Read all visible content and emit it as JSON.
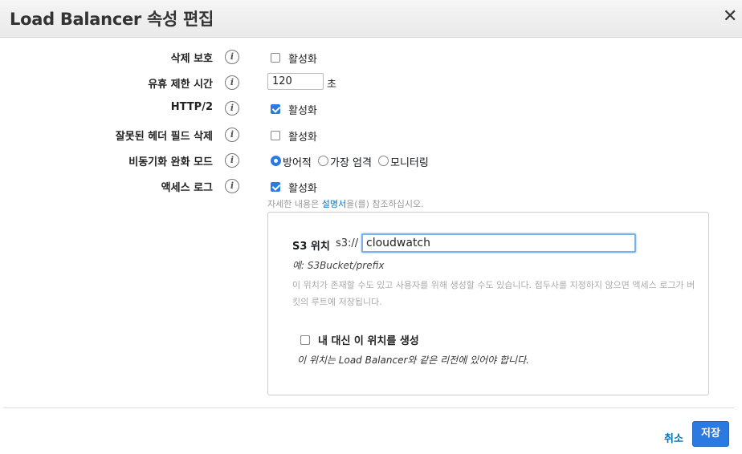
{
  "dialog": {
    "title": "Load Balancer 속성 편집",
    "close_icon": "close-icon"
  },
  "fields": {
    "deletion_protection": {
      "label": "삭제 보호",
      "checkbox_label": "활성화",
      "checked": false
    },
    "idle_timeout": {
      "label": "유휴 제한 시간",
      "value": "120",
      "unit": "초"
    },
    "http2": {
      "label": "HTTP/2",
      "checkbox_label": "활성화",
      "checked": true
    },
    "drop_invalid_headers": {
      "label": "잘못된 헤더 필드 삭제",
      "checkbox_label": "활성화",
      "checked": false
    },
    "desync_mitigation": {
      "label": "비동기화 완화 모드",
      "options": [
        "방어적",
        "가장 엄격",
        "모니터링"
      ],
      "selected": "방어적"
    },
    "access_logs": {
      "label": "액세스 로그",
      "checkbox_label": "활성화",
      "checked": true
    }
  },
  "help": {
    "prefix": "자세한 내용은 ",
    "link": "설명서",
    "suffix": "을(를) 참조하십시오."
  },
  "s3": {
    "label": "S3 위치",
    "scheme": "s3://",
    "value": "cloudwatch",
    "example": "예: S3Bucket/prefix",
    "note": "이 위치가 존재할 수도 있고 사용자를 위해 생성할 수도 있습니다. 접두사를 지정하지 않으면 액세스 로그가 버킷의 루트에 저장됩니다.",
    "create_label": "내 대신 이 위치를 생성",
    "create_checked": false,
    "region_note": "이 위치는 Load Balancer와 같은 리전에 있어야 합니다."
  },
  "footer": {
    "cancel_label": "취소",
    "save_label": "저장"
  },
  "colors": {
    "accent": "#2a7ae2",
    "link": "#0073bb"
  }
}
